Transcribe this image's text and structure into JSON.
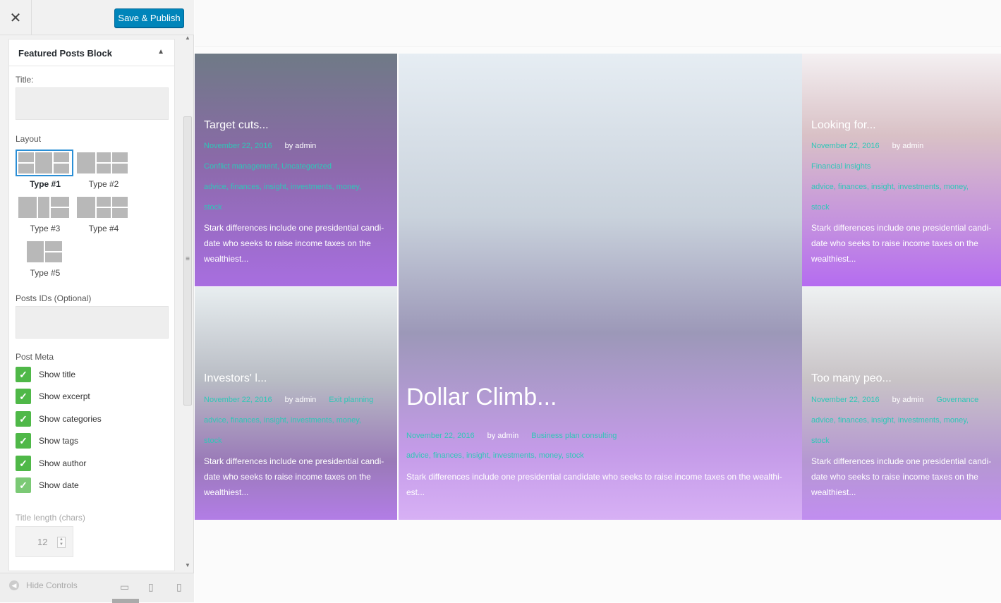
{
  "toolbar": {
    "close_label": "✕",
    "publish_label": "Save & Publish"
  },
  "panel": {
    "title": "Featured Posts Block",
    "collapse_icon": "triangle-up-icon",
    "title_label": "Title:",
    "layout_label": "Layout",
    "layouts": [
      "Type #1",
      "Type #2",
      "Type #3",
      "Type #4",
      "Type #5"
    ],
    "selected_layout": "Type #1",
    "post_ids_label": "Posts IDs (Optional)",
    "post_meta_label": "Post Meta",
    "meta_options": [
      {
        "label": "Show title",
        "checked": true
      },
      {
        "label": "Show excerpt",
        "checked": true
      },
      {
        "label": "Show categories",
        "checked": true
      },
      {
        "label": "Show tags",
        "checked": true
      },
      {
        "label": "Show author",
        "checked": true
      },
      {
        "label": "Show date",
        "checked": true
      }
    ],
    "title_length_label": "Title length (chars)",
    "title_length_value": "12"
  },
  "footer": {
    "hide_controls": "Hide Controls",
    "devices": [
      "desktop-icon",
      "tablet-icon",
      "mobile-icon"
    ]
  },
  "colors": {
    "accent": "#0085ba",
    "check": "#4fb848",
    "meta_teal": "#2fc7b7",
    "overlay_purple": "#b26cf0"
  },
  "posts": [
    {
      "title": "Target cuts...",
      "date": "November 22, 2016",
      "author": "by admin",
      "categories": "Conflict management, Uncategorized",
      "tags": "advice, finances, insight, investments, money,",
      "tags2": "stock",
      "excerpt1": "Stark differences include one presidential candi-",
      "excerpt2": "date who seeks to raise income taxes on the",
      "excerpt3": "wealthiest..."
    },
    {
      "title": "Dollar Climb...",
      "date": "November 22, 2016",
      "author": "by admin",
      "categories": "Business plan consulting",
      "tags": "advice, finances, insight, investments, money, stock",
      "excerpt1": "Stark differences include one presidential candidate who seeks to raise income taxes on the wealthi-",
      "excerpt2": "est..."
    },
    {
      "title": "Looking for...",
      "date": "November 22, 2016",
      "author": "by admin",
      "categories": "Financial insights",
      "tags": "advice, finances, insight, investments, money,",
      "tags2": "stock",
      "excerpt1": "Stark differences include one presidential candi-",
      "excerpt2": "date who seeks to raise income taxes on the",
      "excerpt3": "wealthiest..."
    },
    {
      "title": "Investors' l...",
      "date": "November 22, 2016",
      "author": "by admin",
      "categories": "Exit planning",
      "tags": "advice, finances, insight, investments, money,",
      "tags2": "stock",
      "excerpt1": "Stark differences include one presidential candi-",
      "excerpt2": "date who seeks to raise income taxes on the",
      "excerpt3": "wealthiest..."
    },
    {
      "title": "Too many peo...",
      "date": "November 22, 2016",
      "author": "by admin",
      "categories": "Governance",
      "tags": "advice, finances, insight, investments, money,",
      "tags2": "stock",
      "excerpt1": "Stark differences include one presidential candi-",
      "excerpt2": "date who seeks to raise income taxes on the",
      "excerpt3": "wealthiest..."
    }
  ]
}
